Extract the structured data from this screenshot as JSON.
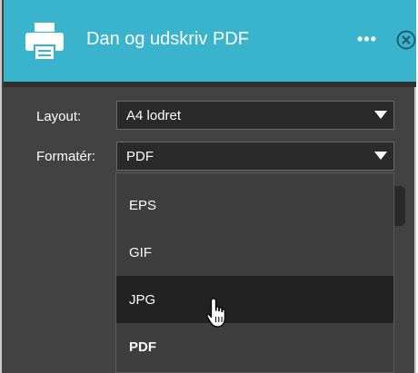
{
  "header": {
    "title": "Dan og udskriv PDF",
    "more_label": "•••",
    "icon": "printer-icon",
    "close_icon": "close-icon",
    "bg_color": "#3ab4cd"
  },
  "form": {
    "layout": {
      "label": "Layout:",
      "value": "A4 lodret"
    },
    "format": {
      "label": "Formatér:",
      "value": "PDF"
    }
  },
  "dropdown": {
    "options": [
      {
        "label": "EPS",
        "hovered": false,
        "selected": false
      },
      {
        "label": "GIF",
        "hovered": false,
        "selected": false
      },
      {
        "label": "JPG",
        "hovered": true,
        "selected": false
      },
      {
        "label": "PDF",
        "hovered": false,
        "selected": true
      }
    ]
  },
  "cursor": "hand-pointer-icon"
}
